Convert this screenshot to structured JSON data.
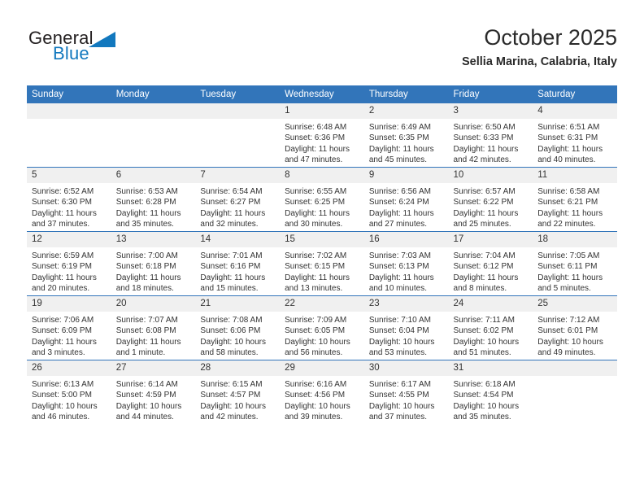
{
  "brand": {
    "name_part1": "General",
    "name_part2": "Blue",
    "accent_color": "#1278be"
  },
  "header": {
    "month_title": "October 2025",
    "location": "Sellia Marina, Calabria, Italy"
  },
  "calendar": {
    "header_bg": "#3275ba",
    "daynum_bg": "#f0f0f0",
    "weekday_headers": [
      "Sunday",
      "Monday",
      "Tuesday",
      "Wednesday",
      "Thursday",
      "Friday",
      "Saturday"
    ],
    "weeks": [
      [
        {
          "day": "",
          "sunrise": "",
          "sunset": "",
          "daylight_line1": "",
          "daylight_line2": ""
        },
        {
          "day": "",
          "sunrise": "",
          "sunset": "",
          "daylight_line1": "",
          "daylight_line2": ""
        },
        {
          "day": "",
          "sunrise": "",
          "sunset": "",
          "daylight_line1": "",
          "daylight_line2": ""
        },
        {
          "day": "1",
          "sunrise": "Sunrise: 6:48 AM",
          "sunset": "Sunset: 6:36 PM",
          "daylight_line1": "Daylight: 11 hours",
          "daylight_line2": "and 47 minutes."
        },
        {
          "day": "2",
          "sunrise": "Sunrise: 6:49 AM",
          "sunset": "Sunset: 6:35 PM",
          "daylight_line1": "Daylight: 11 hours",
          "daylight_line2": "and 45 minutes."
        },
        {
          "day": "3",
          "sunrise": "Sunrise: 6:50 AM",
          "sunset": "Sunset: 6:33 PM",
          "daylight_line1": "Daylight: 11 hours",
          "daylight_line2": "and 42 minutes."
        },
        {
          "day": "4",
          "sunrise": "Sunrise: 6:51 AM",
          "sunset": "Sunset: 6:31 PM",
          "daylight_line1": "Daylight: 11 hours",
          "daylight_line2": "and 40 minutes."
        }
      ],
      [
        {
          "day": "5",
          "sunrise": "Sunrise: 6:52 AM",
          "sunset": "Sunset: 6:30 PM",
          "daylight_line1": "Daylight: 11 hours",
          "daylight_line2": "and 37 minutes."
        },
        {
          "day": "6",
          "sunrise": "Sunrise: 6:53 AM",
          "sunset": "Sunset: 6:28 PM",
          "daylight_line1": "Daylight: 11 hours",
          "daylight_line2": "and 35 minutes."
        },
        {
          "day": "7",
          "sunrise": "Sunrise: 6:54 AM",
          "sunset": "Sunset: 6:27 PM",
          "daylight_line1": "Daylight: 11 hours",
          "daylight_line2": "and 32 minutes."
        },
        {
          "day": "8",
          "sunrise": "Sunrise: 6:55 AM",
          "sunset": "Sunset: 6:25 PM",
          "daylight_line1": "Daylight: 11 hours",
          "daylight_line2": "and 30 minutes."
        },
        {
          "day": "9",
          "sunrise": "Sunrise: 6:56 AM",
          "sunset": "Sunset: 6:24 PM",
          "daylight_line1": "Daylight: 11 hours",
          "daylight_line2": "and 27 minutes."
        },
        {
          "day": "10",
          "sunrise": "Sunrise: 6:57 AM",
          "sunset": "Sunset: 6:22 PM",
          "daylight_line1": "Daylight: 11 hours",
          "daylight_line2": "and 25 minutes."
        },
        {
          "day": "11",
          "sunrise": "Sunrise: 6:58 AM",
          "sunset": "Sunset: 6:21 PM",
          "daylight_line1": "Daylight: 11 hours",
          "daylight_line2": "and 22 minutes."
        }
      ],
      [
        {
          "day": "12",
          "sunrise": "Sunrise: 6:59 AM",
          "sunset": "Sunset: 6:19 PM",
          "daylight_line1": "Daylight: 11 hours",
          "daylight_line2": "and 20 minutes."
        },
        {
          "day": "13",
          "sunrise": "Sunrise: 7:00 AM",
          "sunset": "Sunset: 6:18 PM",
          "daylight_line1": "Daylight: 11 hours",
          "daylight_line2": "and 18 minutes."
        },
        {
          "day": "14",
          "sunrise": "Sunrise: 7:01 AM",
          "sunset": "Sunset: 6:16 PM",
          "daylight_line1": "Daylight: 11 hours",
          "daylight_line2": "and 15 minutes."
        },
        {
          "day": "15",
          "sunrise": "Sunrise: 7:02 AM",
          "sunset": "Sunset: 6:15 PM",
          "daylight_line1": "Daylight: 11 hours",
          "daylight_line2": "and 13 minutes."
        },
        {
          "day": "16",
          "sunrise": "Sunrise: 7:03 AM",
          "sunset": "Sunset: 6:13 PM",
          "daylight_line1": "Daylight: 11 hours",
          "daylight_line2": "and 10 minutes."
        },
        {
          "day": "17",
          "sunrise": "Sunrise: 7:04 AM",
          "sunset": "Sunset: 6:12 PM",
          "daylight_line1": "Daylight: 11 hours",
          "daylight_line2": "and 8 minutes."
        },
        {
          "day": "18",
          "sunrise": "Sunrise: 7:05 AM",
          "sunset": "Sunset: 6:11 PM",
          "daylight_line1": "Daylight: 11 hours",
          "daylight_line2": "and 5 minutes."
        }
      ],
      [
        {
          "day": "19",
          "sunrise": "Sunrise: 7:06 AM",
          "sunset": "Sunset: 6:09 PM",
          "daylight_line1": "Daylight: 11 hours",
          "daylight_line2": "and 3 minutes."
        },
        {
          "day": "20",
          "sunrise": "Sunrise: 7:07 AM",
          "sunset": "Sunset: 6:08 PM",
          "daylight_line1": "Daylight: 11 hours",
          "daylight_line2": "and 1 minute."
        },
        {
          "day": "21",
          "sunrise": "Sunrise: 7:08 AM",
          "sunset": "Sunset: 6:06 PM",
          "daylight_line1": "Daylight: 10 hours",
          "daylight_line2": "and 58 minutes."
        },
        {
          "day": "22",
          "sunrise": "Sunrise: 7:09 AM",
          "sunset": "Sunset: 6:05 PM",
          "daylight_line1": "Daylight: 10 hours",
          "daylight_line2": "and 56 minutes."
        },
        {
          "day": "23",
          "sunrise": "Sunrise: 7:10 AM",
          "sunset": "Sunset: 6:04 PM",
          "daylight_line1": "Daylight: 10 hours",
          "daylight_line2": "and 53 minutes."
        },
        {
          "day": "24",
          "sunrise": "Sunrise: 7:11 AM",
          "sunset": "Sunset: 6:02 PM",
          "daylight_line1": "Daylight: 10 hours",
          "daylight_line2": "and 51 minutes."
        },
        {
          "day": "25",
          "sunrise": "Sunrise: 7:12 AM",
          "sunset": "Sunset: 6:01 PM",
          "daylight_line1": "Daylight: 10 hours",
          "daylight_line2": "and 49 minutes."
        }
      ],
      [
        {
          "day": "26",
          "sunrise": "Sunrise: 6:13 AM",
          "sunset": "Sunset: 5:00 PM",
          "daylight_line1": "Daylight: 10 hours",
          "daylight_line2": "and 46 minutes."
        },
        {
          "day": "27",
          "sunrise": "Sunrise: 6:14 AM",
          "sunset": "Sunset: 4:59 PM",
          "daylight_line1": "Daylight: 10 hours",
          "daylight_line2": "and 44 minutes."
        },
        {
          "day": "28",
          "sunrise": "Sunrise: 6:15 AM",
          "sunset": "Sunset: 4:57 PM",
          "daylight_line1": "Daylight: 10 hours",
          "daylight_line2": "and 42 minutes."
        },
        {
          "day": "29",
          "sunrise": "Sunrise: 6:16 AM",
          "sunset": "Sunset: 4:56 PM",
          "daylight_line1": "Daylight: 10 hours",
          "daylight_line2": "and 39 minutes."
        },
        {
          "day": "30",
          "sunrise": "Sunrise: 6:17 AM",
          "sunset": "Sunset: 4:55 PM",
          "daylight_line1": "Daylight: 10 hours",
          "daylight_line2": "and 37 minutes."
        },
        {
          "day": "31",
          "sunrise": "Sunrise: 6:18 AM",
          "sunset": "Sunset: 4:54 PM",
          "daylight_line1": "Daylight: 10 hours",
          "daylight_line2": "and 35 minutes."
        },
        {
          "day": "",
          "sunrise": "",
          "sunset": "",
          "daylight_line1": "",
          "daylight_line2": ""
        }
      ]
    ]
  }
}
